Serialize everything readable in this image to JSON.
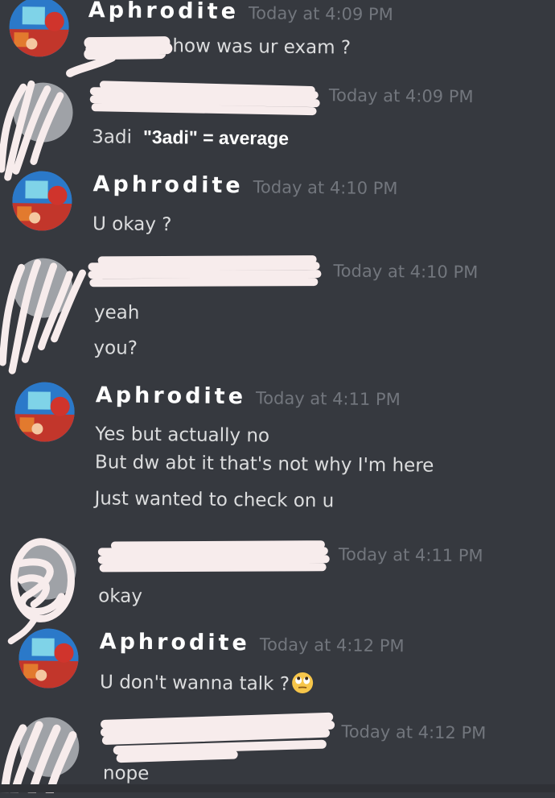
{
  "channel_messages": [
    {
      "author": "Aphrodite",
      "timestamp": "Today at 4:09 PM",
      "lines": [
        "how was ur exam ?"
      ]
    },
    {
      "author": "",
      "timestamp": "Today at 4:09 PM",
      "lines": [
        "3adi"
      ],
      "note": "\"3adi\" = average"
    },
    {
      "author": "Aphrodite",
      "timestamp": "Today at 4:10 PM",
      "lines": [
        "U okay ?"
      ]
    },
    {
      "author": "",
      "timestamp": "Today at 4:10 PM",
      "lines": [
        "yeah",
        "you?"
      ]
    },
    {
      "author": "Aphrodite",
      "timestamp": "Today at 4:11 PM",
      "lines": [
        "Yes but actually no",
        "But dw abt it that's not why I'm here",
        "Just wanted to check on u"
      ]
    },
    {
      "author": "",
      "timestamp": "Today at 4:11 PM",
      "lines": [
        "okay"
      ]
    },
    {
      "author": "Aphrodite",
      "timestamp": "Today at 4:12 PM",
      "lines": [
        "U don't wanna talk ?"
      ],
      "emoji": "rolling-eyes-emoji"
    },
    {
      "author": "",
      "timestamp": "Today at 4:12 PM",
      "lines": [
        "nope"
      ]
    }
  ],
  "colors": {
    "background": "#36393f",
    "username": "#ffffff",
    "timestamp": "#72767d",
    "message_text": "#dcddde",
    "redaction": "#f7ecec"
  }
}
